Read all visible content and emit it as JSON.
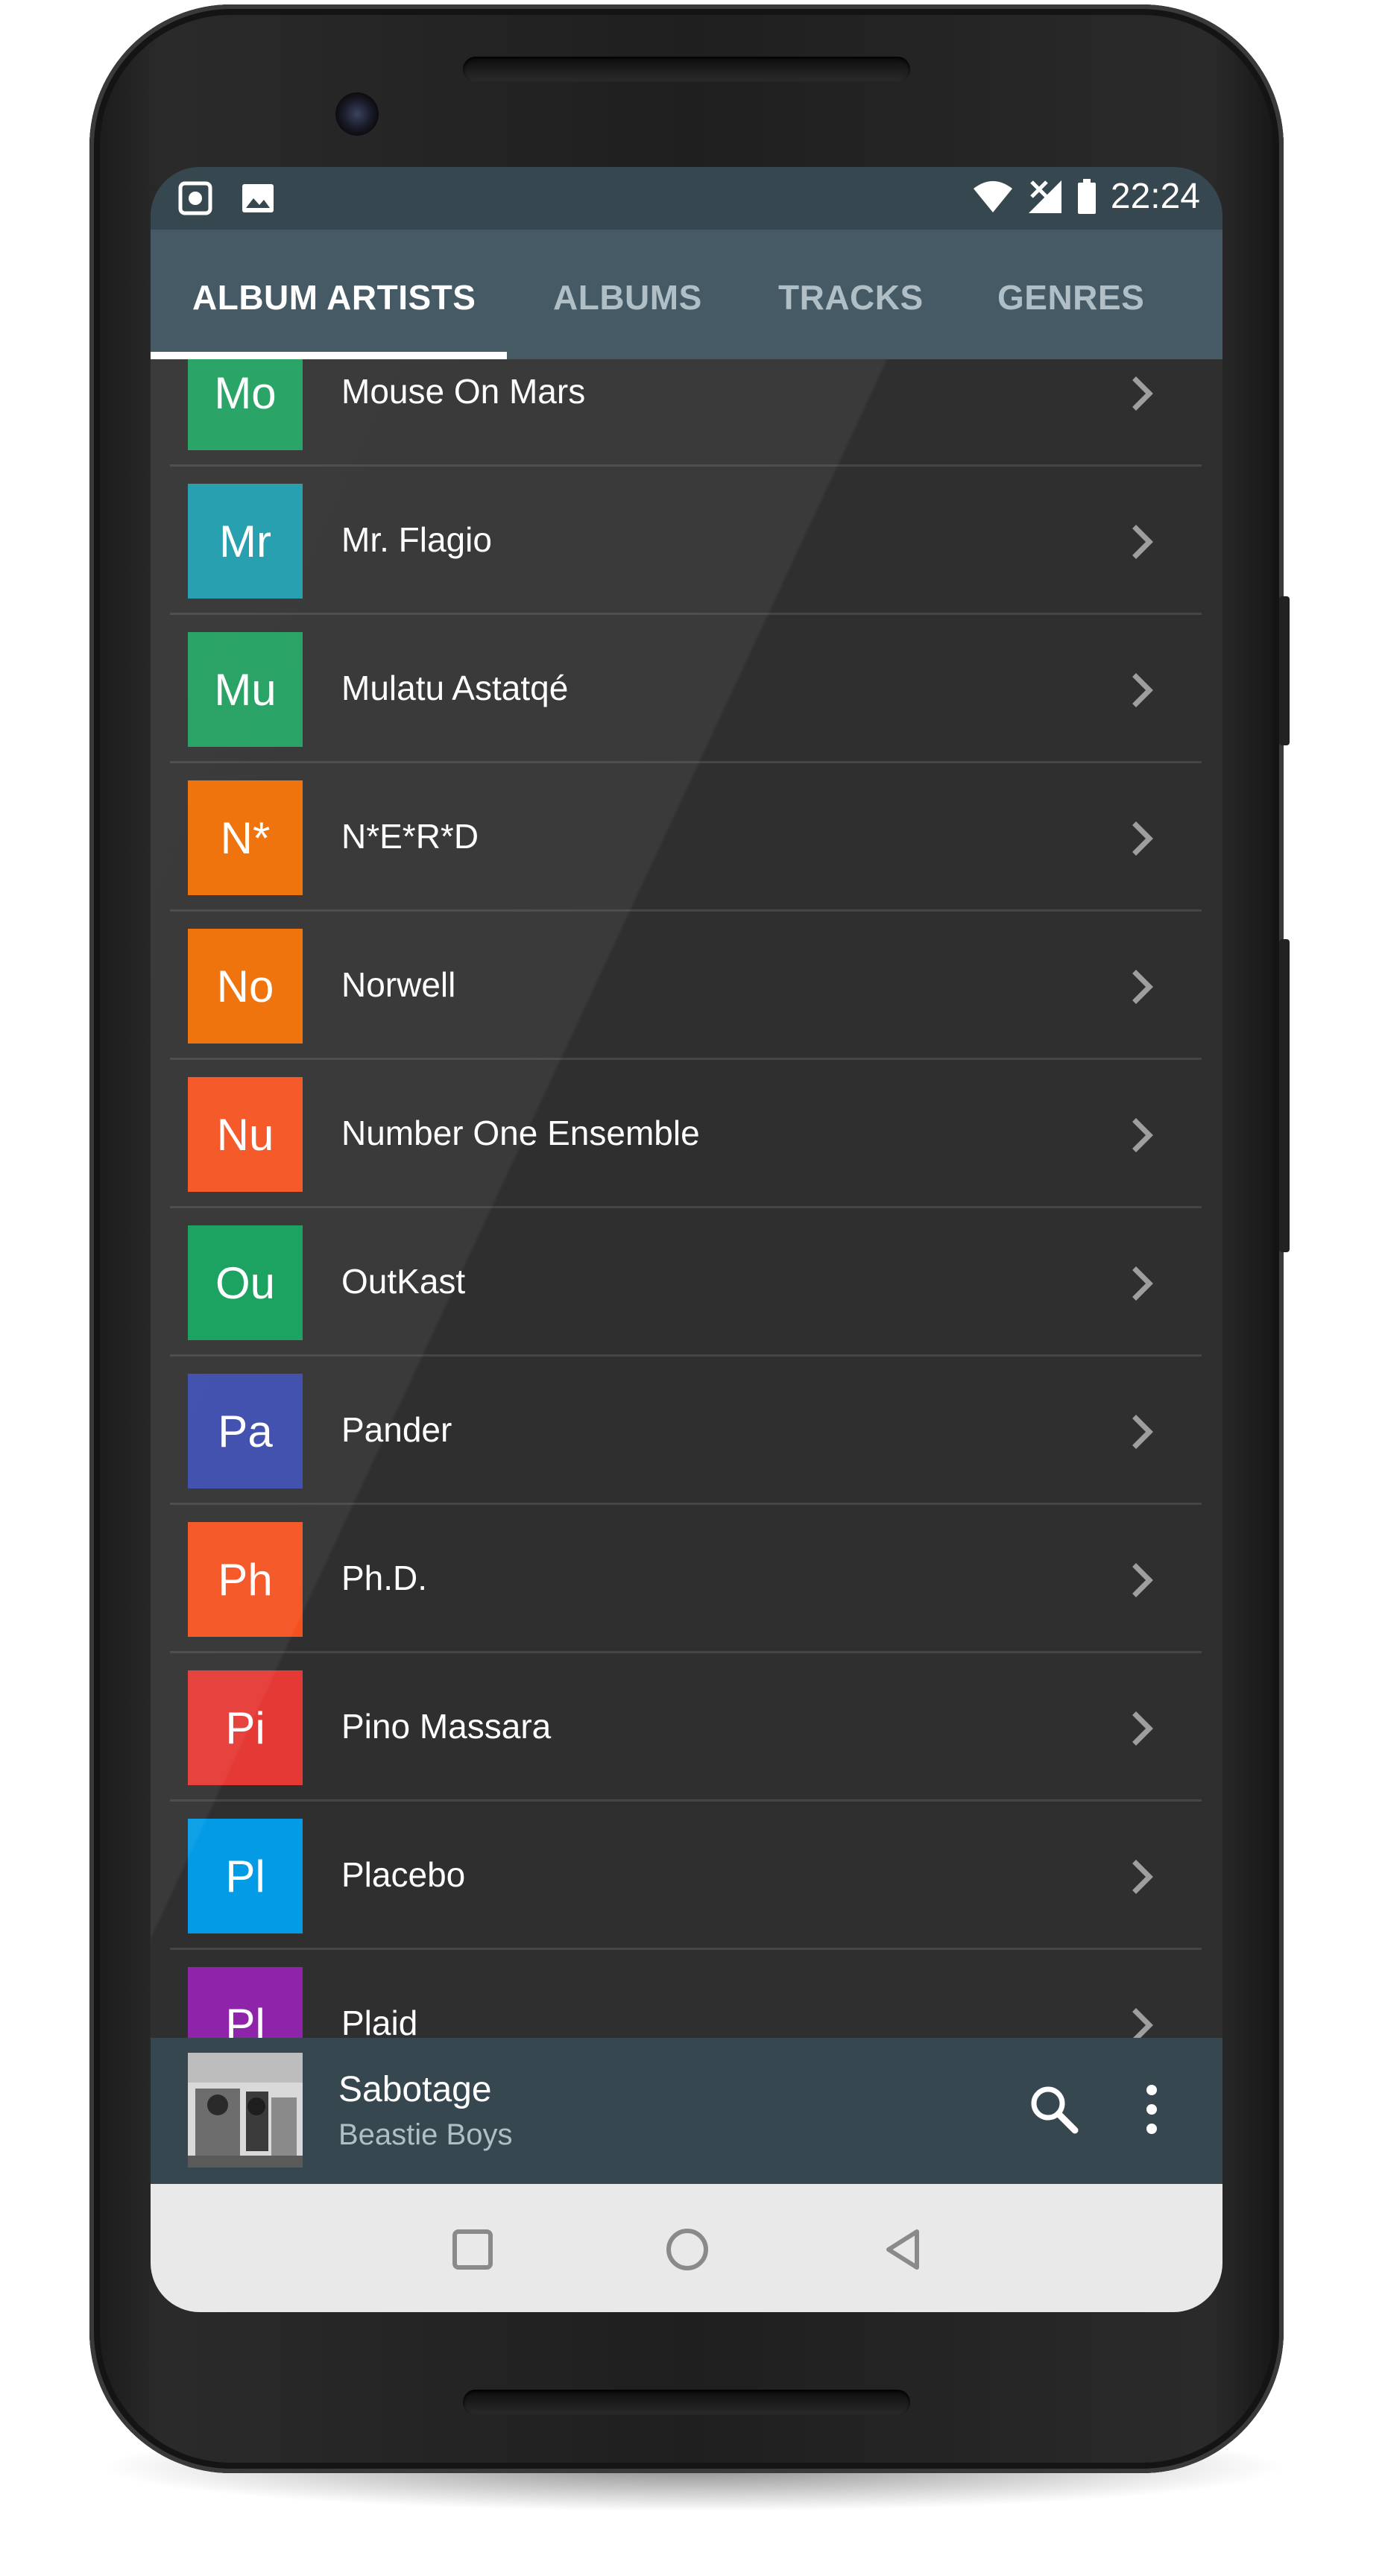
{
  "status_bar": {
    "time": "22:24",
    "left_icons": [
      "screen-record-icon",
      "image-icon"
    ],
    "right_icons": [
      "wifi-icon",
      "cell-signal-icon",
      "battery-icon"
    ]
  },
  "tabs": [
    {
      "label": "ALBUM ARTISTS",
      "active": true
    },
    {
      "label": "ALBUMS",
      "active": false
    },
    {
      "label": "TRACKS",
      "active": false
    },
    {
      "label": "GENRES",
      "active": false
    }
  ],
  "artists": [
    {
      "initials": "Mo",
      "name": "Mouse On Mars",
      "color": "#1e9e5e"
    },
    {
      "initials": "Mr",
      "name": "Mr. Flagio",
      "color": "#1b9aaa"
    },
    {
      "initials": "Mu",
      "name": "Mulatu Astatqé",
      "color": "#1e9e5e"
    },
    {
      "initials": "N*",
      "name": "N*E*R*D",
      "color": "#ef6c00"
    },
    {
      "initials": "No",
      "name": "Norwell",
      "color": "#ef6c00"
    },
    {
      "initials": "Nu",
      "name": "Number One Ensemble",
      "color": "#f4511e"
    },
    {
      "initials": "Ou",
      "name": "OutKast",
      "color": "#0f9d58"
    },
    {
      "initials": "Pa",
      "name": "Pander",
      "color": "#3949ab"
    },
    {
      "initials": "Ph",
      "name": "Ph.D.",
      "color": "#f4511e"
    },
    {
      "initials": "Pi",
      "name": "Pino Massara",
      "color": "#e53935"
    },
    {
      "initials": "Pl",
      "name": "Placebo",
      "color": "#039be5"
    },
    {
      "initials": "Pl",
      "name": "Plaid",
      "color": "#8e24aa"
    }
  ],
  "now_playing": {
    "title": "Sabotage",
    "artist": "Beastie Boys",
    "icons": [
      "search-icon",
      "more-vert-icon"
    ]
  },
  "nav_bar": {
    "icons": [
      "recents-square-icon",
      "home-circle-icon",
      "back-triangle-icon"
    ]
  },
  "colors": {
    "status_bar": "#37474f",
    "tab_bar": "#455a64",
    "list_background": "#2f2f2f",
    "now_playing_bar": "#37474f",
    "nav_bar": "#e9e9e9"
  }
}
